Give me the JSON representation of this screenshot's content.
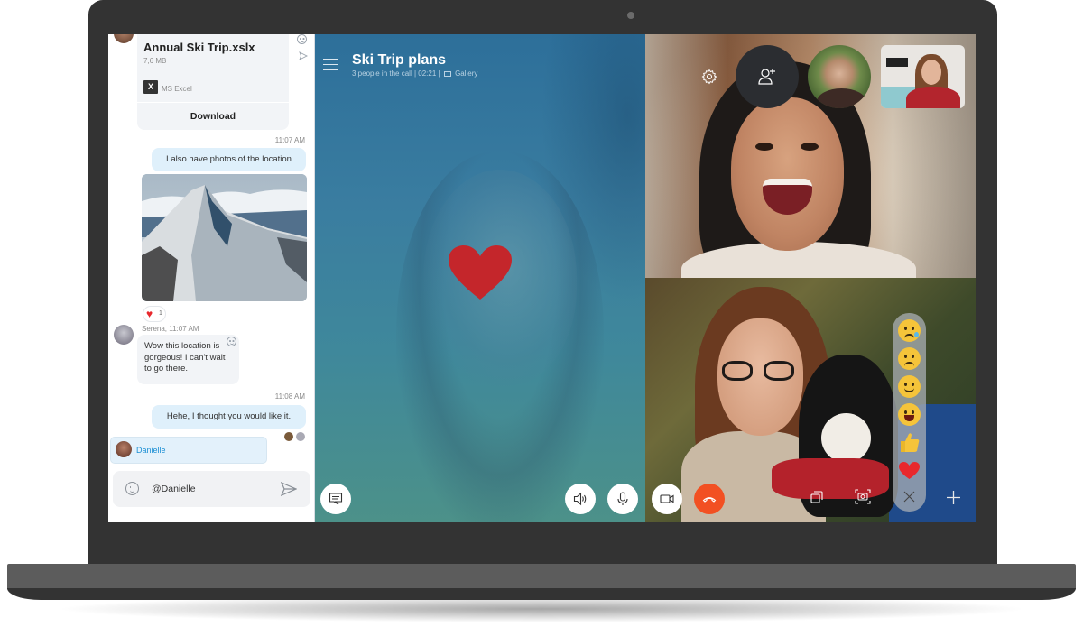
{
  "chat": {
    "file": {
      "name": "Annual Ski Trip.xslx",
      "size": "7,6 MB",
      "type_icon": "X",
      "type_label": "MS Excel",
      "download_label": "Download"
    },
    "messages": [
      {
        "time": "11:07 AM",
        "text": "I also have photos of the location",
        "direction": "outgoing"
      },
      {
        "type": "photo",
        "alt": "Snowy mountain ridge",
        "reaction": {
          "emoji": "heart",
          "count": "1"
        }
      },
      {
        "sender_line": "Serena, 11:07 AM",
        "text": "Wow this location is gorgeous! I can't wait to go there.",
        "direction": "incoming"
      },
      {
        "time": "11:08 AM",
        "text": "Hehe, I thought you would like it.",
        "direction": "outgoing"
      }
    ],
    "mention_suggestion": "Danielle",
    "composer": {
      "value": "@Danielle",
      "placeholder": ""
    }
  },
  "call": {
    "title": "Ski Trip plans",
    "participants": "3 people in the call",
    "duration": "02:21",
    "view_mode": "Gallery",
    "reactions": [
      "worried-face",
      "crying-face",
      "smiling-face",
      "laughing-face",
      "thumbs-up",
      "heart"
    ],
    "controls": [
      "chat",
      "speaker",
      "microphone",
      "video",
      "end-call",
      "switch-camera",
      "snapshot",
      "add"
    ]
  },
  "colors": {
    "accent": "#1b8fd4",
    "end_call": "#f25022",
    "bubble_out": "#dff0fb",
    "bubble_in": "#f2f4f7"
  }
}
